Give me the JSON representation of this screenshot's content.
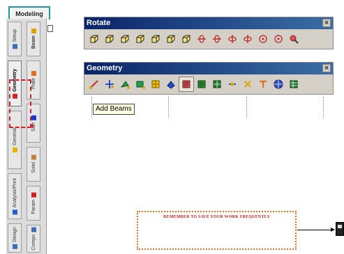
{
  "modeling_tab": {
    "label": "Modeling"
  },
  "left_tabs": [
    {
      "label": "Setup",
      "icon": "setup-icon",
      "color": "#3d6fb0"
    },
    {
      "label": "Geometry",
      "icon": "geometry-icon",
      "color": "#d0202a",
      "selected": true
    },
    {
      "label": "General",
      "icon": "general-icon",
      "color": "#e8b000"
    },
    {
      "label": "Analysis/Print",
      "icon": "analysis-icon",
      "color": "#2060c0"
    },
    {
      "label": "Design",
      "icon": "design-icon",
      "color": "#3d6fb0"
    }
  ],
  "inner_tabs": [
    {
      "label": "Beam",
      "icon": "beam-icon",
      "color": "#e0a000"
    },
    {
      "label": "Plate",
      "icon": "plate-icon",
      "color": "#e07020"
    },
    {
      "label": "Surf",
      "icon": "surface-icon",
      "color": "#1a3ad0"
    },
    {
      "label": "Solid",
      "icon": "solid-icon",
      "color": "#c08040"
    },
    {
      "label": "Param",
      "icon": "param-icon",
      "color": "#d02020"
    },
    {
      "label": "Compo",
      "icon": "compo-icon",
      "color": "#3d6fb0"
    }
  ],
  "rotate_toolbar": {
    "title": "Rotate",
    "close_label": "×",
    "buttons": [
      "rotate-view-1-icon",
      "rotate-view-2-icon",
      "rotate-view-3-icon",
      "rotate-view-4-icon",
      "rotate-view-5-icon",
      "rotate-view-6-icon",
      "rotate-view-7-icon",
      "rotate-x-pos-icon",
      "rotate-x-neg-icon",
      "rotate-y-pos-icon",
      "rotate-y-neg-icon",
      "rotate-z-pos-icon",
      "rotate-z-neg-icon",
      "dynamic-rotate-icon"
    ]
  },
  "geometry_toolbar": {
    "title": "Geometry",
    "close_label": "×",
    "buttons": [
      "add-beam-icon",
      "add-node-icon",
      "add-plate-icon",
      "add-surface-icon",
      "add-solid-icon",
      "snap-grid-icon",
      "generate-plate-mesh-icon",
      "generate-surface-mesh-icon",
      "generate-solid-mesh-icon",
      "split-member-icon",
      "merge-icon",
      "translational-repeat-icon",
      "circular-repeat-icon",
      "mirror-icon"
    ],
    "pressed_index": 6
  },
  "tooltip": {
    "text": "Add Beams"
  },
  "reminder": {
    "text": "REMEMBER TO SAVE YOUR WORK FREQUENTLY"
  }
}
